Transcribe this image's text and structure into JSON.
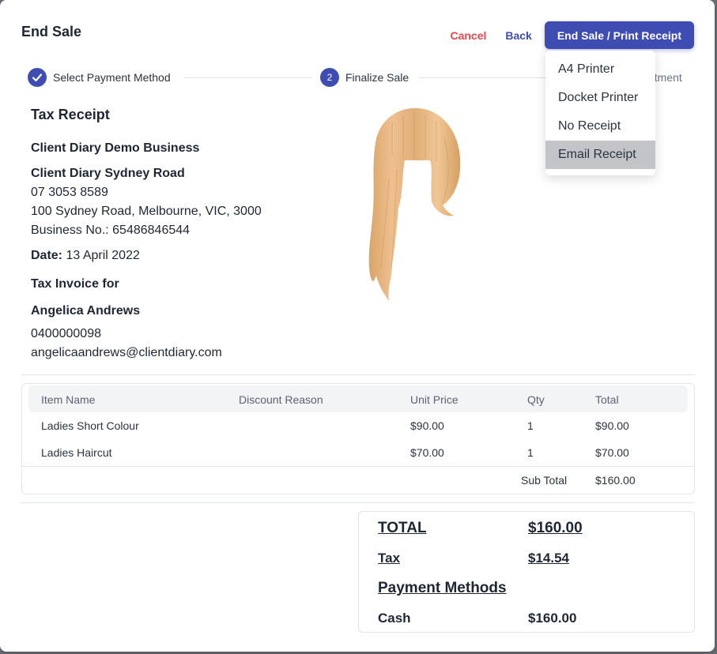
{
  "modal": {
    "title": "End Sale"
  },
  "actions": {
    "cancel": "Cancel",
    "back": "Back",
    "primary": "End Sale / Print Receipt"
  },
  "print_menu": {
    "items": [
      "A4 Printer",
      "Docket Printer",
      "No Receipt",
      "Email Receipt"
    ],
    "highlighted": "Email Receipt"
  },
  "stepper": {
    "steps": [
      {
        "label": "Select Payment Method",
        "state": "complete"
      },
      {
        "number": "2",
        "label": "Finalize Sale",
        "state": "current"
      },
      {
        "label_visible_fragment": "ntment",
        "state": "upcoming"
      }
    ]
  },
  "receipt": {
    "heading": "Tax Receipt",
    "business_name": "Client Diary Demo Business",
    "location_name": "Client Diary Sydney Road",
    "phone": "07 3053 8589",
    "address": "100 Sydney Road, Melbourne, VIC, 3000",
    "business_no": "Business No.: 65486846544",
    "date_label": "Date:",
    "date_value": "13 April 2022",
    "invoice_for": "Tax Invoice for",
    "client_name": "Angelica Andrews",
    "client_phone": "0400000098",
    "client_email": "angelicaandrews@clientdiary.com"
  },
  "items_table": {
    "headers": [
      "Item Name",
      "Discount Reason",
      "Unit Price",
      "Qty",
      "Total"
    ],
    "rows": [
      [
        "Ladies Short Colour",
        "",
        "$90.00",
        "1",
        "$90.00"
      ],
      [
        "Ladies Haircut",
        "",
        "$70.00",
        "1",
        "$70.00"
      ]
    ],
    "subtotal_label": "Sub Total",
    "subtotal_value": "$160.00"
  },
  "totals": {
    "total_label": "TOTAL",
    "total_value": "$160.00",
    "tax_label": "Tax",
    "tax_value": "$14.54",
    "payment_methods_label": "Payment Methods",
    "payments": [
      {
        "method": "Cash",
        "amount": "$160.00"
      }
    ]
  },
  "colors": {
    "primary": "#3f4db3",
    "cancel": "#e5484d",
    "wood": "#e2b27c"
  }
}
